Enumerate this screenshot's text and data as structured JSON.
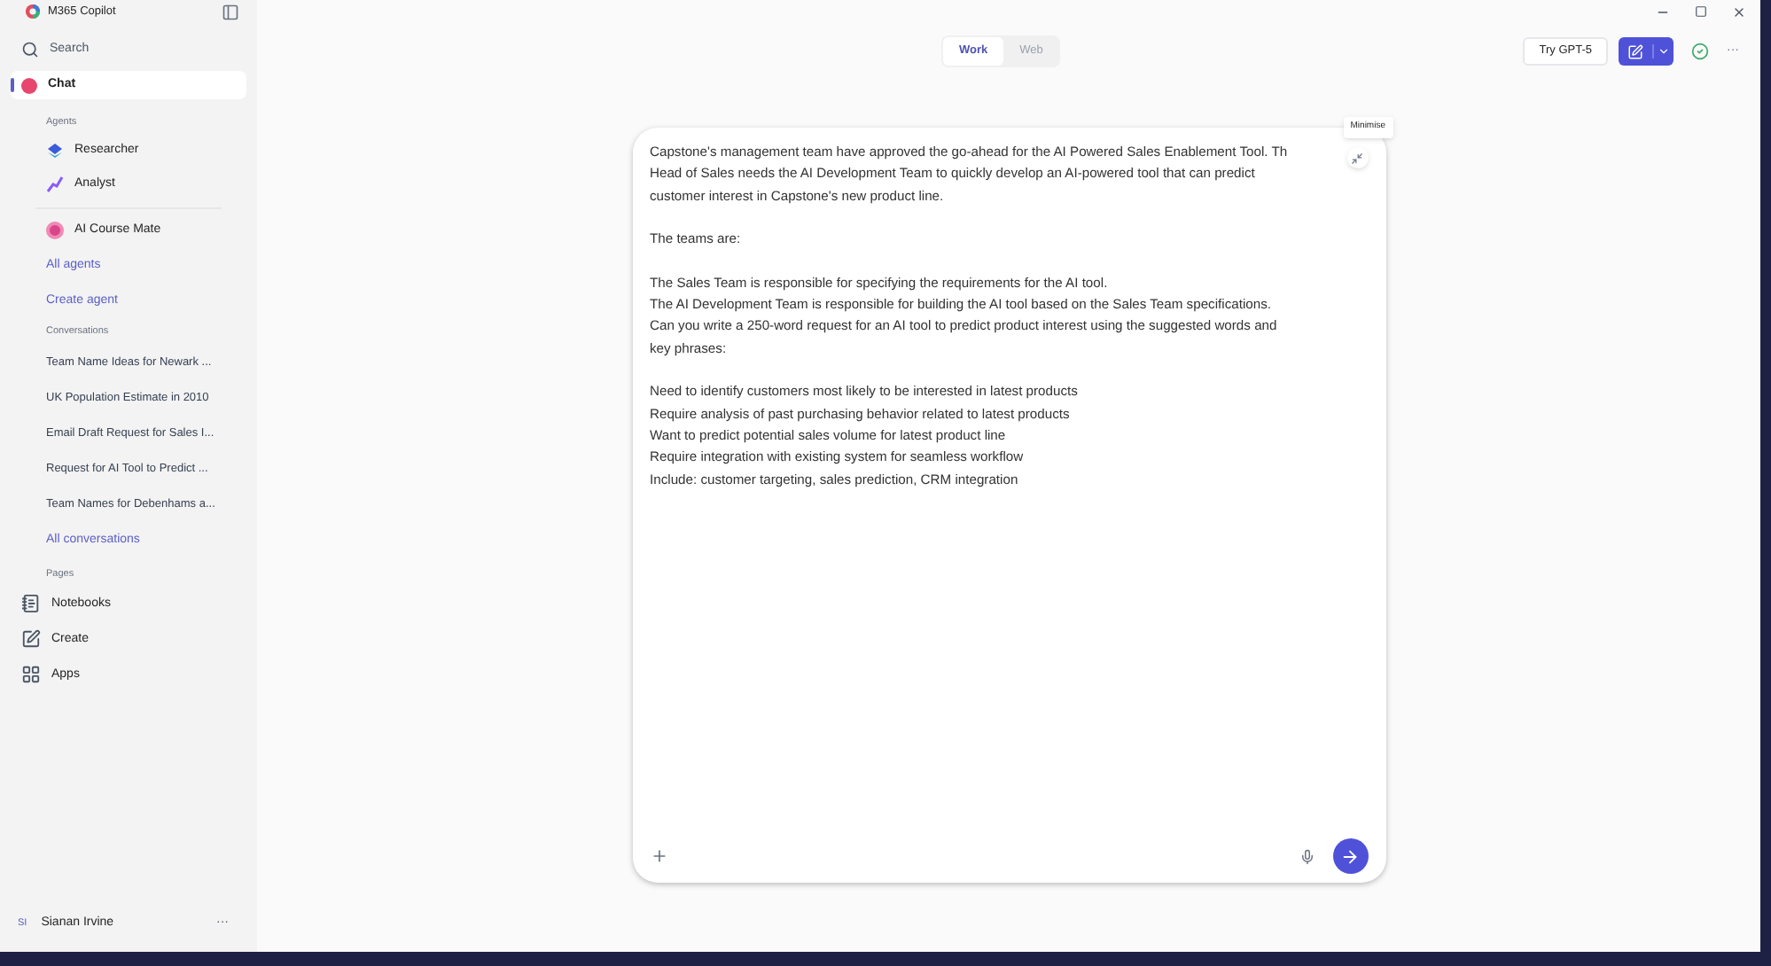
{
  "app": {
    "title": "M365 Copilot"
  },
  "sidebar": {
    "search": "Search",
    "chat": {
      "label": "Chat",
      "selected": true
    },
    "agents_heading": "Agents",
    "agents": [
      {
        "label": "Researcher",
        "kind": "researcher"
      },
      {
        "label": "Analyst",
        "kind": "analyst"
      },
      {
        "label": "AI Course Mate",
        "kind": "coursemate"
      }
    ],
    "agent_links": [
      "All agents",
      "Create agent"
    ],
    "conversations_heading": "Conversations",
    "conversations": [
      "Team Name Ideas for Newark ...",
      "UK Population Estimate in 2010",
      "Email Draft Request for Sales I...",
      "Request for AI Tool to Predict ...",
      "Team Names for Debenhams a..."
    ],
    "conversations_link": "All conversations",
    "pages_heading": "Pages",
    "pages": [
      {
        "label": "Notebooks",
        "kind": "notebook"
      },
      {
        "label": "Create",
        "kind": "create"
      },
      {
        "label": "Apps",
        "kind": "apps"
      }
    ],
    "user": {
      "initials": "SI",
      "name": "Sianan Irvine",
      "more": "···"
    }
  },
  "topbar": {
    "tabs": [
      {
        "label": "Work",
        "selected": true
      },
      {
        "label": "Web",
        "selected": false
      }
    ],
    "try_button": "Try GPT-5",
    "more": "···"
  },
  "composer": {
    "tooltip": "Minimise",
    "blocks": [
      [
        "Capstone's management team have approved the go-ahead for the AI Powered Sales Enablement Tool. Th",
        "Head of Sales needs the AI Development Team to quickly develop an AI-powered tool that can predict",
        "customer interest in Capstone's new product line."
      ],
      [
        "The teams are:"
      ],
      [
        "The Sales Team is responsible for specifying the requirements for the AI tool.",
        "The AI Development Team is responsible for building the AI tool based on the Sales Team specifications.",
        "Can you write a 250-word request for an AI tool to predict product interest using the suggested words and",
        "key phrases:"
      ],
      [
        "Need to identify customers most likely to be interested in latest products",
        "Require analysis of past purchasing behavior related to latest products",
        "Want to predict potential sales volume for latest product line",
        "Require integration with existing system for seamless workflow",
        "Include: customer targeting, sales prediction, CRM integration"
      ]
    ]
  }
}
